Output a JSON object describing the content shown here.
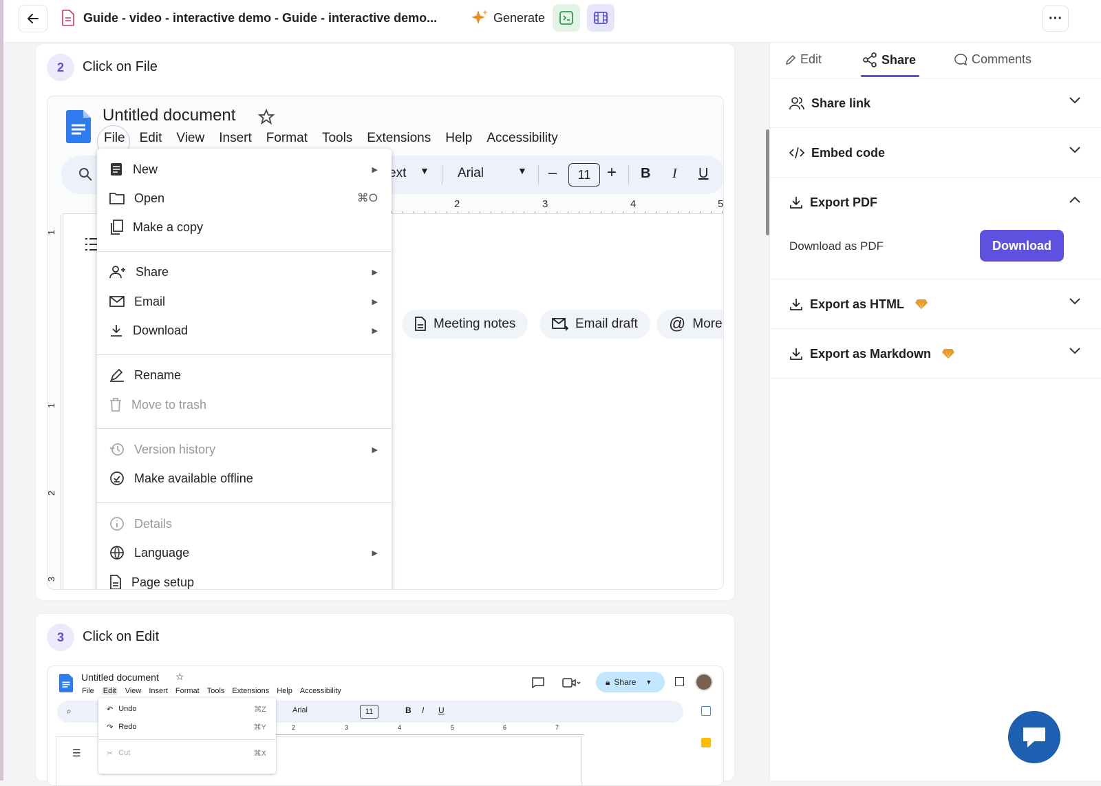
{
  "topbar": {
    "doc_title": "Guide - video - interactive demo - Guide - interactive demo...",
    "generate_label": "Generate",
    "more_label": "···"
  },
  "steps": [
    {
      "number": "2",
      "label": "Click on File"
    },
    {
      "number": "3",
      "label": "Click on Edit"
    }
  ],
  "gdoc": {
    "title": "Untitled document",
    "menu": [
      "File",
      "Edit",
      "View",
      "Insert",
      "Format",
      "Tools",
      "Extensions",
      "Help",
      "Accessibility"
    ],
    "toolbar": {
      "style_partial": "ext",
      "font": "Arial",
      "size": "11",
      "bold": "B",
      "italic": "I",
      "underline": "U",
      "minus": "–",
      "plus": "+"
    },
    "ruler": [
      "2",
      "3",
      "4",
      "5"
    ],
    "side_ruler": [
      "1",
      "1",
      "2",
      "3"
    ],
    "file_menu": [
      {
        "label": "New",
        "icon": "document-icon",
        "arrow": true
      },
      {
        "label": "Open",
        "icon": "folder-icon",
        "shortcut": "⌘O"
      },
      {
        "label": "Make a copy",
        "icon": "copy-icon"
      },
      {
        "label": "Share",
        "icon": "person-add-icon",
        "arrow": true
      },
      {
        "label": "Email",
        "icon": "mail-icon",
        "arrow": true
      },
      {
        "label": "Download",
        "icon": "download-icon",
        "arrow": true
      },
      {
        "label": "Rename",
        "icon": "pencil-icon"
      },
      {
        "label": "Move to trash",
        "icon": "trash-icon",
        "disabled": true
      },
      {
        "label": "Version history",
        "icon": "history-icon",
        "arrow": true,
        "disabled": true
      },
      {
        "label": "Make available offline",
        "icon": "offline-icon"
      },
      {
        "label": "Details",
        "icon": "info-icon",
        "disabled": true
      },
      {
        "label": "Language",
        "icon": "globe-icon",
        "arrow": true
      },
      {
        "label": "Page setup",
        "icon": "page-icon"
      }
    ],
    "chips": [
      "Meeting notes",
      "Email draft",
      "More"
    ]
  },
  "gdoc_small": {
    "title": "Untitled document",
    "menu": [
      "File",
      "Edit",
      "View",
      "Insert",
      "Format",
      "Tools",
      "Extensions",
      "Help",
      "Accessibility"
    ],
    "share_label": "Share",
    "font": "Arial",
    "size": "11",
    "ruler": [
      "2",
      "3",
      "4",
      "5",
      "6",
      "7"
    ],
    "edit_menu": [
      {
        "label": "Undo",
        "shortcut": "⌘Z"
      },
      {
        "label": "Redo",
        "shortcut": "⌘Y"
      },
      {
        "label": "Cut",
        "shortcut": "⌘X",
        "disabled": true
      }
    ]
  },
  "sidebar": {
    "tabs": [
      {
        "label": "Edit",
        "icon": "pencil-icon"
      },
      {
        "label": "Share",
        "icon": "share-icon",
        "active": true
      },
      {
        "label": "Comments",
        "icon": "comment-icon"
      }
    ],
    "sections": [
      {
        "label": "Share link",
        "icon": "users-icon",
        "expanded": false
      },
      {
        "label": "Embed code",
        "icon": "code-icon",
        "expanded": false
      },
      {
        "label": "Export PDF",
        "icon": "download-icon",
        "expanded": true
      },
      {
        "label": "Export as HTML",
        "icon": "download-icon",
        "expanded": false,
        "premium": true
      },
      {
        "label": "Export as Markdown",
        "icon": "download-icon",
        "expanded": false,
        "premium": true
      }
    ],
    "pdf": {
      "text": "Download as PDF",
      "button": "Download"
    }
  },
  "colors": {
    "accent": "#5f51e0",
    "premium": "#e89a2c",
    "chat": "#1d5fb0"
  }
}
